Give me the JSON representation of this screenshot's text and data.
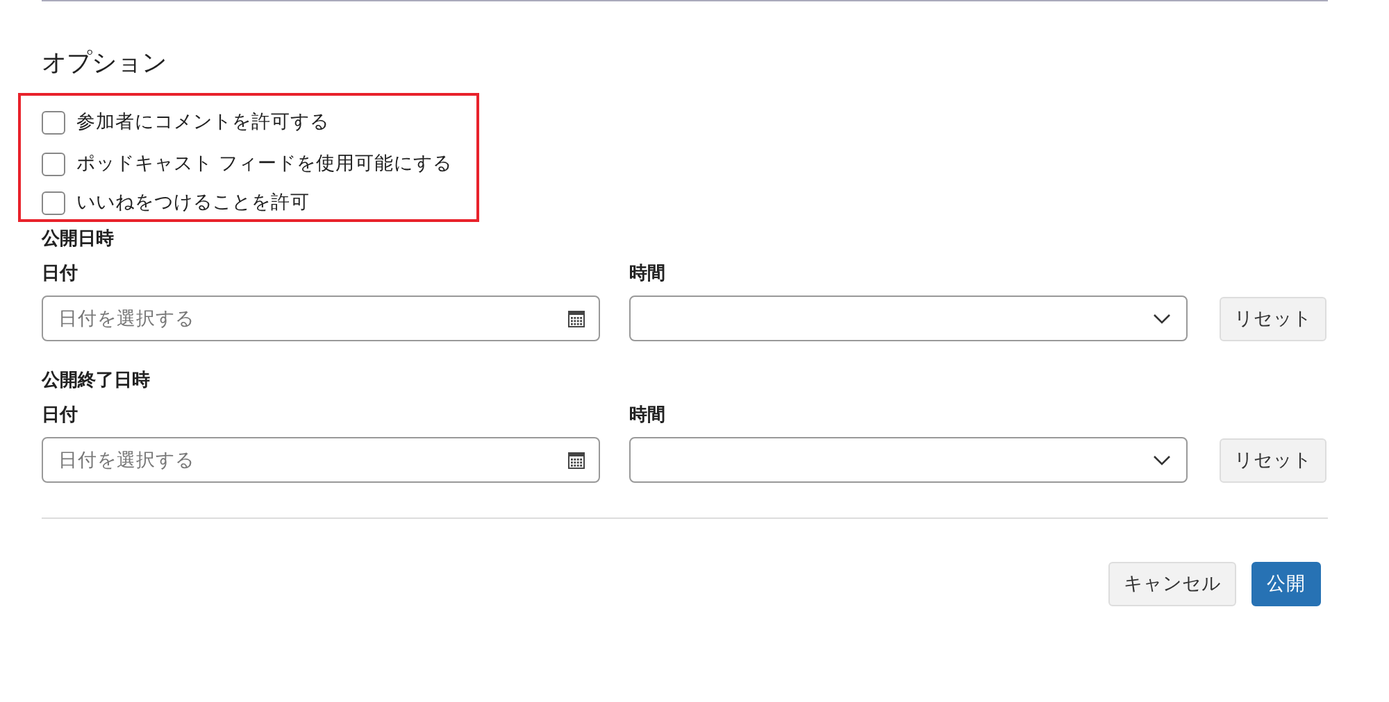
{
  "options": {
    "title": "オプション",
    "highlighted": true,
    "items": [
      {
        "label": "参加者にコメントを許可する",
        "checked": false
      },
      {
        "label": "ポッドキャスト フィードを使用可能にする",
        "checked": false
      },
      {
        "label": "いいねをつけることを許可",
        "checked": false
      }
    ]
  },
  "schedules": [
    {
      "title": "公開日時",
      "date_label": "日付",
      "date_placeholder": "日付を選択する",
      "time_label": "時間",
      "reset": "リセット"
    },
    {
      "title": "公開終了日時",
      "date_label": "日付",
      "date_placeholder": "日付を選択する",
      "time_label": "時間",
      "reset": "リセット"
    }
  ],
  "buttons": [
    {
      "label": "キャンセル",
      "kind": "secondary"
    },
    {
      "label": "公開",
      "kind": "primary"
    }
  ]
}
